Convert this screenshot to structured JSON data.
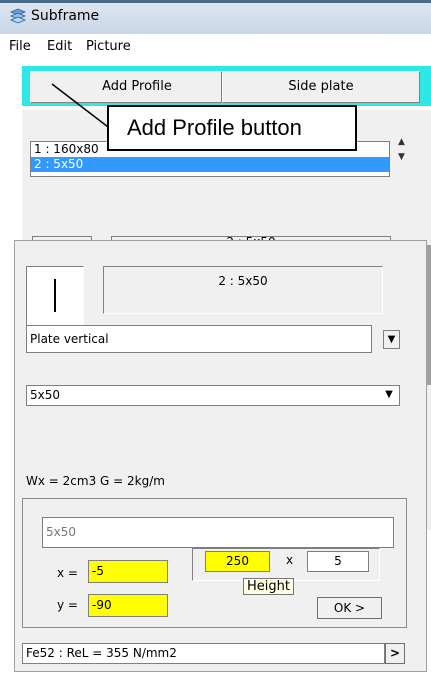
{
  "window": {
    "title": "Subframe"
  },
  "menu": [
    "File",
    "Edit",
    "Picture"
  ],
  "toolbar": {
    "add_profile": "Add Profile",
    "side_plate": "Side plate"
  },
  "profile_list": [
    "1 : 160x80",
    "2 : 5x50"
  ],
  "back_preview": {
    "label": "2 : 5x50"
  },
  "callout": "Add Profile button",
  "dialog": {
    "profile_label": "2 : 5x50",
    "orientation": "Plate vertical",
    "section": "5x50",
    "properties": "Wx = 2cm3   G = 2kg/m",
    "name_field": "5x50",
    "x_label": "x =",
    "x_value": "-5",
    "y_label": "y =",
    "y_value": "-90",
    "height_value": "250",
    "times": "x",
    "thickness_value": "5",
    "tooltip": "Height",
    "ok": "OK >",
    "material": "Fe52 : ReL = 355 N/mm2",
    "material_arrow": ">"
  },
  "colors": {
    "accent_band": "#2ee8e8",
    "highlight_field": "#ffff00",
    "selection": "#3399ff"
  },
  "icons": [
    "subframe-app-icon",
    "chevron-down-icon",
    "scroll-up-icon",
    "scroll-down-icon",
    "arrow-right-icon"
  ]
}
